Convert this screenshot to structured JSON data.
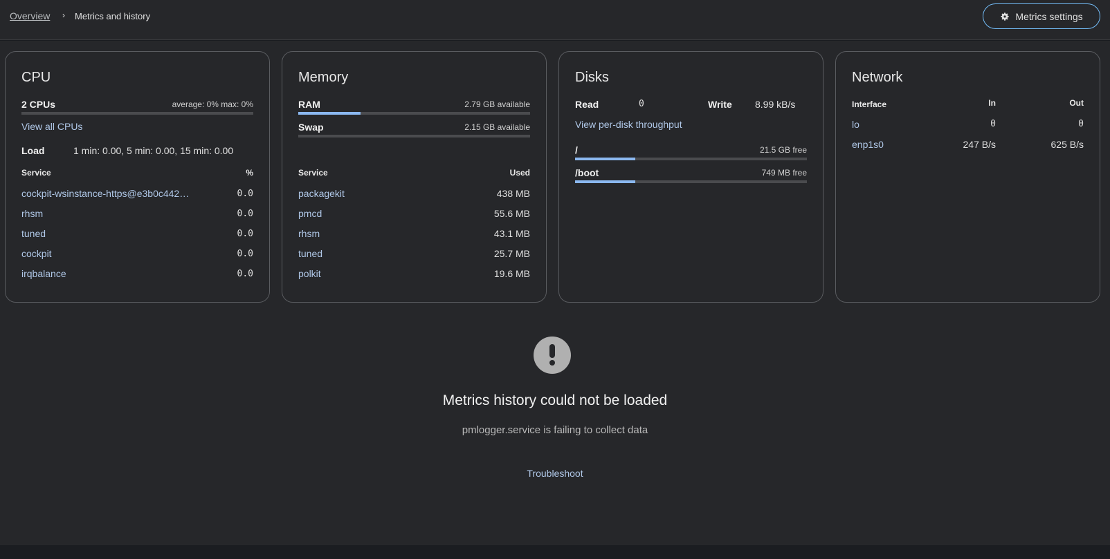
{
  "breadcrumb": {
    "overview": "Overview",
    "separator": "›",
    "current": "Metrics and history"
  },
  "header": {
    "settings_label": "Metrics settings",
    "settings_icon": "gear-icon"
  },
  "cpu": {
    "title": "CPU",
    "count_label": "2 CPUs",
    "usage_summary": "average: 0% max: 0%",
    "usage_fraction": 0,
    "view_all": "View all CPUs",
    "load_label": "Load",
    "load_values": "1 min: 0.00, 5 min: 0.00, 15 min: 0.00",
    "table": {
      "col_service": "Service",
      "col_value": "%",
      "rows": [
        {
          "name": "cockpit-wsinstance-https@e3b0c442…",
          "value": "0.0"
        },
        {
          "name": "rhsm",
          "value": "0.0"
        },
        {
          "name": "tuned",
          "value": "0.0"
        },
        {
          "name": "cockpit",
          "value": "0.0"
        },
        {
          "name": "irqbalance",
          "value": "0.0"
        }
      ]
    }
  },
  "memory": {
    "title": "Memory",
    "ram_label": "RAM",
    "ram_available": "2.79 GB available",
    "ram_used_fraction": 0.27,
    "swap_label": "Swap",
    "swap_available": "2.15 GB available",
    "swap_used_fraction": 0,
    "table": {
      "col_service": "Service",
      "col_value": "Used",
      "rows": [
        {
          "name": "packagekit",
          "value": "438 MB"
        },
        {
          "name": "pmcd",
          "value": "55.6 MB"
        },
        {
          "name": "rhsm",
          "value": "43.1 MB"
        },
        {
          "name": "tuned",
          "value": "25.7 MB"
        },
        {
          "name": "polkit",
          "value": "19.6 MB"
        }
      ]
    }
  },
  "disks": {
    "title": "Disks",
    "read_label": "Read",
    "read_value": "0",
    "write_label": "Write",
    "write_value": "8.99 kB/s",
    "view_per_disk": "View per-disk throughput",
    "mounts": [
      {
        "name": "/",
        "free": "21.5 GB free",
        "used_fraction": 0.26
      },
      {
        "name": "/boot",
        "free": "749 MB free",
        "used_fraction": 0.26
      }
    ]
  },
  "network": {
    "title": "Network",
    "col_interface": "Interface",
    "col_in": "In",
    "col_out": "Out",
    "rows": [
      {
        "name": "lo",
        "in": "0",
        "out": "0"
      },
      {
        "name": "enp1s0",
        "in": "247 B/s",
        "out": "625 B/s"
      }
    ]
  },
  "error": {
    "icon": "exclamation-circle-icon",
    "title": "Metrics history could not be loaded",
    "subtitle": "pmlogger.service is failing to collect data",
    "action": "Troubleshoot"
  }
}
